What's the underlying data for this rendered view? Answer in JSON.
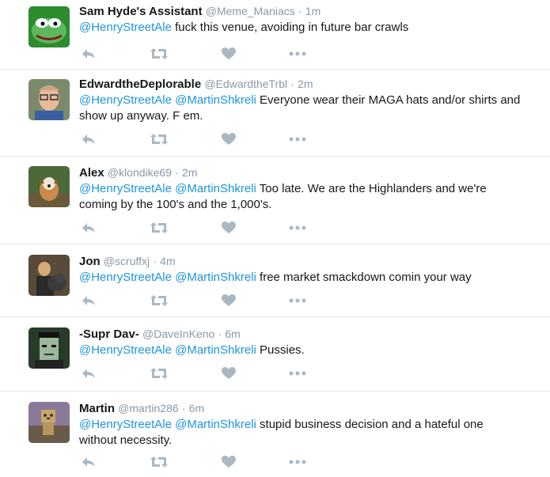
{
  "tweets": [
    {
      "name": "Sam Hyde's Assistant",
      "handle": "@Meme_Maniacs",
      "time": "1m",
      "mentions": "@HenryStreetAle",
      "body": " fuck this venue, avoiding in future bar crawls",
      "avatar": "frog-avatar"
    },
    {
      "name": "EdwardtheDeplorable",
      "handle": "@EdwardtheTrbl",
      "time": "2m",
      "mentions": "@HenryStreetAle @MartinShkreli",
      "body": " Everyone wear their MAGA hats and/or shirts and show up anyway. F em.",
      "avatar": "man-glasses-avatar"
    },
    {
      "name": "Alex",
      "handle": "@klondike69",
      "time": "2m",
      "mentions": "@HenryStreetAle @MartinShkreli",
      "body": " Too late. We are the Highlanders and we're coming by the 100's and the 1,000's.",
      "avatar": "dog-avatar"
    },
    {
      "name": "Jon",
      "handle": "@scruffxj",
      "time": "4m",
      "mentions": "@HenryStreetAle @MartinShkreli",
      "body": " free market smackdown comin your way",
      "avatar": "man-dog-avatar"
    },
    {
      "name": "-Supr Dav-",
      "handle": "@DaveInKeno",
      "time": "6m",
      "mentions": "@HenryStreetAle @MartinShkreli",
      "body": " Pussies.",
      "avatar": "monster-avatar"
    },
    {
      "name": "Martin",
      "handle": "@martin286",
      "time": "6m",
      "mentions": "@HenryStreetAle @MartinShkreli",
      "body": " stupid business decision and a hateful one without necessity.",
      "avatar": "box-figure-avatar"
    }
  ],
  "separator": "·",
  "icons": {
    "reply": "reply-icon",
    "retweet": "retweet-icon",
    "like": "heart-icon",
    "more": "more-icon"
  },
  "colors": {
    "mention": "#1b95e0",
    "meta": "#8899a6",
    "icon": "#aab8c2",
    "divider": "#e1e8ed"
  }
}
